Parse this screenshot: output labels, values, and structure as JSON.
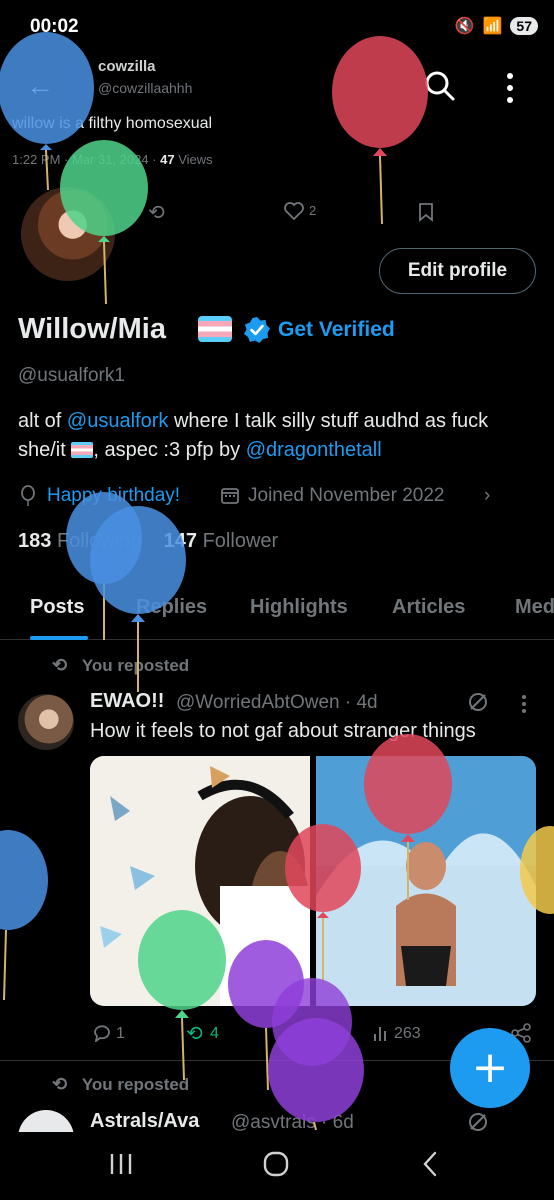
{
  "status_bar": {
    "time": "00:02",
    "battery": "57",
    "network": "5G"
  },
  "peek_tweet": {
    "name": "cowzilla",
    "handle": "@cowzillaahhh",
    "text": "willow is a filthy homosexual",
    "time": "1:22 PM · Mar 31, 2024 ·",
    "views_count": "47",
    "views_label": "Views",
    "likes": "2"
  },
  "profile": {
    "edit_profile": "Edit profile",
    "display_name": "Willow/Mia",
    "get_verified": "Get Verified",
    "username": "@usualfork1",
    "bio": {
      "alt_of": "alt of ",
      "alt_mention": "@usualfork",
      "part1": " where I talk silly stuff audhd as fuck she/it ",
      "part2": ", aspec :3 pfp by ",
      "pfp_mention": "@dragonthetall"
    },
    "birthday": "Happy birthday!",
    "joined": "Joined November 2022",
    "following_count": "183",
    "following_label": "Following",
    "followers_count": "147",
    "followers_label": "Follower"
  },
  "tabs": [
    "Posts",
    "Replies",
    "Highlights",
    "Articles",
    "Media"
  ],
  "tweets": [
    {
      "repost_label": "You reposted",
      "name": "EWAO!!",
      "handle": "@WorriedAbtOwen · 4d",
      "text": "How it feels to not gaf about stranger things",
      "replies": "1",
      "reposts": "4",
      "views": "263"
    },
    {
      "repost_label": "You reposted",
      "name": "Astrals/Ava",
      "handle": "@asvtrals · 6d"
    }
  ],
  "fab_label": "+",
  "colors": {
    "accent": "#1d9bf0",
    "repost_green": "#00ba7c",
    "balloon_blue": "#4a90e2",
    "balloon_red": "#e0475b",
    "balloon_green": "#4fd38a",
    "balloon_purple": "#8e3fd8",
    "balloon_yellow": "#f2c94c"
  },
  "icons": [
    "back-arrow-icon",
    "search-icon",
    "more-icon",
    "verified-icon",
    "balloon-icon",
    "calendar-icon",
    "repost-icon",
    "mute-icon",
    "reply-icon",
    "like-icon",
    "bookmark-icon",
    "views-icon",
    "share-icon",
    "plus-icon"
  ]
}
